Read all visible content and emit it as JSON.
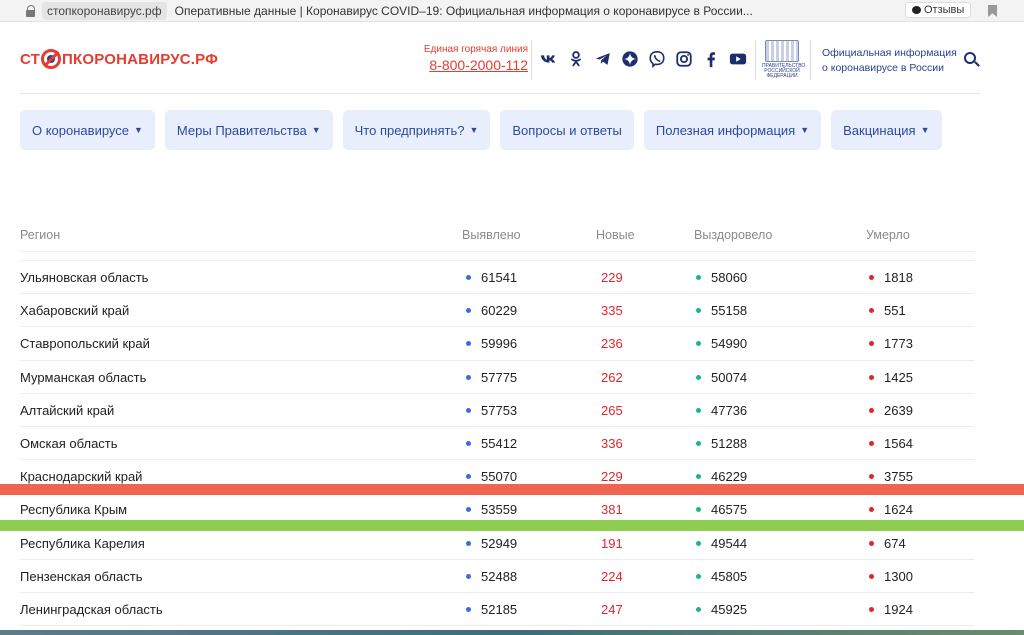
{
  "browser": {
    "domain": "стопкоронавирус.рф",
    "tab_title": "Оперативные данные | Коронавирус COVID–19: Официальная информация о коронавирусе в России...",
    "reviews_label": "Отзывы"
  },
  "header": {
    "logo_part1": "СТ",
    "logo_part2": "ПКОРОНАВИРУС",
    "logo_part3": ".РФ",
    "hotline_label": "Единая горячая линия",
    "hotline_phone": "8-800-2000-112",
    "social_icons": [
      "vk-icon",
      "odnoklassniki-icon",
      "telegram-icon",
      "yandex-zen-icon",
      "viber-icon",
      "instagram-icon",
      "facebook-icon",
      "youtube-icon"
    ],
    "emblem_caption": "ПРАВИТЕЛЬСТВО РОССИЙСКОЙ ФЕДЕРАЦИИ",
    "official_info": "Официальная информация о коронавирусе в России"
  },
  "nav": {
    "tabs": [
      {
        "label": "О коронавирусе",
        "dropdown": true
      },
      {
        "label": "Меры Правительства",
        "dropdown": true
      },
      {
        "label": "Что предпринять?",
        "dropdown": true
      },
      {
        "label": "Вопросы и ответы",
        "dropdown": false
      },
      {
        "label": "Полезная информация",
        "dropdown": true
      },
      {
        "label": "Вакцинация",
        "dropdown": true
      }
    ]
  },
  "table": {
    "headers": {
      "region": "Регион",
      "detected": "Выявлено",
      "new": "Новые",
      "recovered": "Выздоровело",
      "died": "Умерло"
    },
    "rows": [
      {
        "region": "Ульяновская область",
        "detected": "61541",
        "new": "229",
        "recovered": "58060",
        "died": "1818"
      },
      {
        "region": "Хабаровский край",
        "detected": "60229",
        "new": "335",
        "recovered": "55158",
        "died": "551"
      },
      {
        "region": "Ставропольский край",
        "detected": "59996",
        "new": "236",
        "recovered": "54990",
        "died": "1773"
      },
      {
        "region": "Мурманская область",
        "detected": "57775",
        "new": "262",
        "recovered": "50074",
        "died": "1425"
      },
      {
        "region": "Алтайский край",
        "detected": "57753",
        "new": "265",
        "recovered": "47736",
        "died": "2639"
      },
      {
        "region": "Омская область",
        "detected": "55412",
        "new": "336",
        "recovered": "51288",
        "died": "1564"
      },
      {
        "region": "Краснодарский край",
        "detected": "55070",
        "new": "229",
        "recovered": "46229",
        "died": "3755"
      },
      {
        "region": "Республика Крым",
        "detected": "53559",
        "new": "381",
        "recovered": "46575",
        "died": "1624"
      },
      {
        "region": "Республика Карелия",
        "detected": "52949",
        "new": "191",
        "recovered": "49544",
        "died": "674"
      },
      {
        "region": "Пензенская область",
        "detected": "52488",
        "new": "224",
        "recovered": "45805",
        "died": "1300"
      },
      {
        "region": "Ленинградская область",
        "detected": "52185",
        "new": "247",
        "recovered": "45925",
        "died": "1924"
      }
    ]
  },
  "colors": {
    "brand_red": "#e63c2f",
    "brand_blue": "#2a3f8f",
    "detected_dot": "#3b6fd8",
    "recovered_dot": "#1bb58a",
    "died_dot": "#e0262c",
    "highlight_red": "#f26452",
    "highlight_green": "#8ecd52"
  }
}
